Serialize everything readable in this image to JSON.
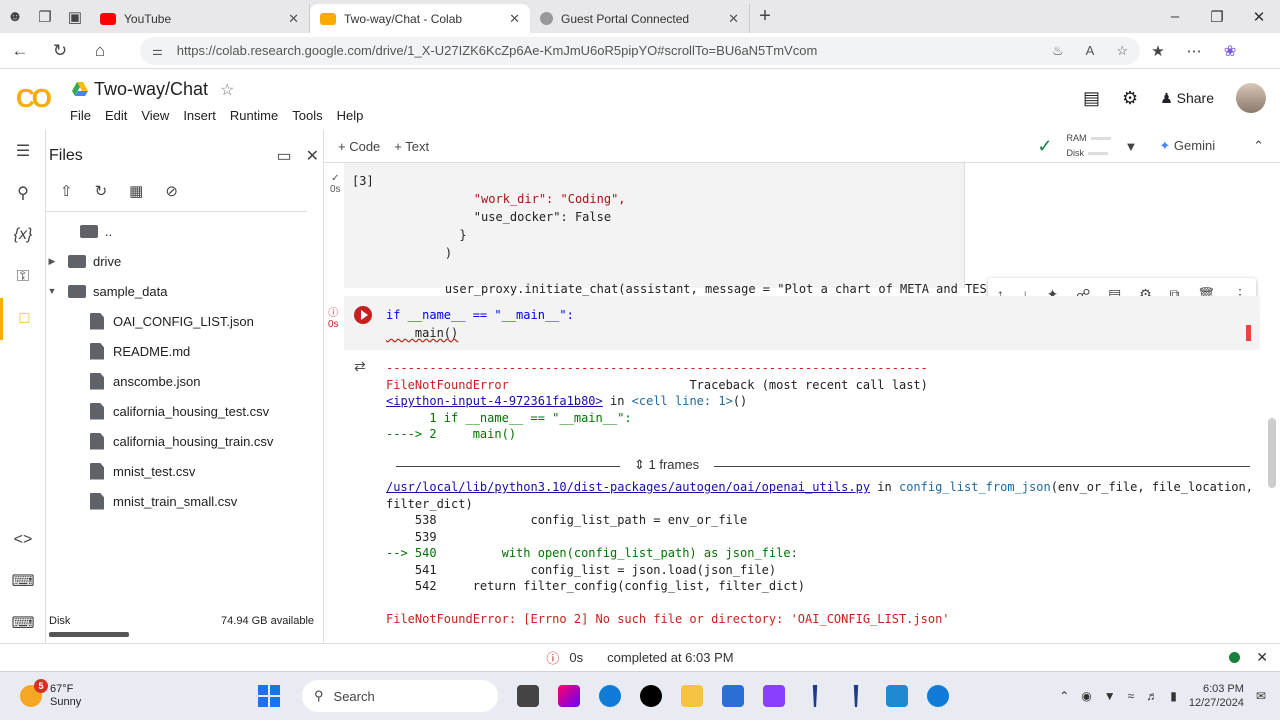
{
  "browser": {
    "tabs": [
      {
        "label": "YouTube",
        "color": "#ff0000"
      },
      {
        "label": "Two-way/Chat - Colab",
        "color": "#f9ab00"
      },
      {
        "label": "Guest Portal Connected",
        "color": "#888888"
      }
    ],
    "url": "https://colab.research.google.com/drive/1_X-U27IZK6KcZp6Ae-KmJmU6oR5pipYO#scrollTo=BU6aN5TmVcom"
  },
  "colab": {
    "logo": "CO",
    "title": "Two-way/Chat",
    "menu": [
      "File",
      "Edit",
      "View",
      "Insert",
      "Runtime",
      "Tools",
      "Help"
    ],
    "share_label": "Share",
    "add_code": "+ Code",
    "add_text": "+ Text",
    "ram_label": "RAM",
    "disk_label": "Disk",
    "gemini_label": "Gemini"
  },
  "files": {
    "title": "Files",
    "items": [
      {
        "name": "..",
        "type": "up"
      },
      {
        "name": "drive",
        "type": "folder",
        "collapsed": true
      },
      {
        "name": "sample_data",
        "type": "folder",
        "expanded": true
      },
      {
        "name": "OAI_CONFIG_LIST.json",
        "type": "file"
      },
      {
        "name": "README.md",
        "type": "file"
      },
      {
        "name": "anscombe.json",
        "type": "file"
      },
      {
        "name": "california_housing_test.csv",
        "type": "file"
      },
      {
        "name": "california_housing_train.csv",
        "type": "file"
      },
      {
        "name": "mnist_test.csv",
        "type": "file"
      },
      {
        "name": "mnist_train_small.csv",
        "type": "file"
      }
    ],
    "disk_label": "Disk",
    "disk_avail": "74.94 GB available"
  },
  "cells": {
    "cell1": {
      "exec_count": "[3]",
      "time": "0s",
      "lines": [
        "        \"work_dir\": \"Coding\",",
        "        \"use_docker\": False",
        "      }",
        "    )",
        "",
        "    user_proxy.initiate_chat(assistant, message = \"Plot a chart of META and TESLA stock price change.\")"
      ]
    },
    "cell2": {
      "time": "0s",
      "code1": "if __name__ == \"__main__\":",
      "code2": "    main()"
    },
    "output": {
      "dashes": "---------------------------------------------------------------------------",
      "err": "FileNotFoundError",
      "traceback": "Traceback (most recent call last)",
      "input_link": "<ipython-input-4-972361fa1b80>",
      "in": " in ",
      "cell_line": "<cell line: 1>",
      "paren": "()",
      "l1": "      1 if __name__ == \"__main__\":",
      "l2": "----> 2     main()",
      "frames": "1 frames",
      "path": "/usr/local/lib/python3.10/dist-packages/autogen/oai/openai_utils.py",
      "func": "config_list_from_json",
      "args": "(env_or_file, file_location,",
      "args2": "filter_dict)",
      "t538": "    538             config_list_path = env_or_file",
      "t539": "    539",
      "t540": "--> 540         with open(config_list_path) as json_file:",
      "t541": "    541             config_list = json.load(json_file)",
      "t542": "    542     return filter_config(config_list, filter_dict)",
      "final": "FileNotFoundError: [Errno 2] No such file or directory: 'OAI_CONFIG_LIST.json'"
    }
  },
  "status": {
    "time": "0s",
    "text": "completed at 6:03 PM"
  },
  "taskbar": {
    "temp": "67°F",
    "cond": "Sunny",
    "badge": "5",
    "search": "Search",
    "time": "6:03 PM",
    "date": "12/27/2024"
  }
}
